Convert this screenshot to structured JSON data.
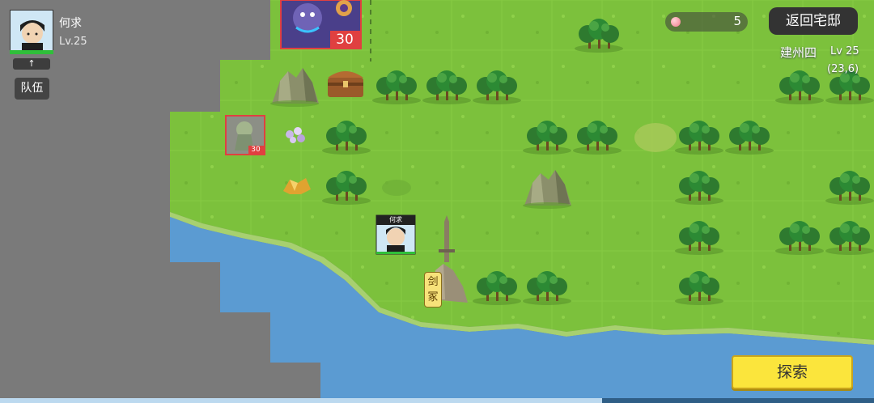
{
  "player": {
    "name": "何求",
    "level": "Lv.25",
    "expand_icon": "up-arrow-icon",
    "up_glyph": "↑",
    "team_label": "队伍"
  },
  "top_right": {
    "peach_icon": "peach-icon",
    "peach_count": "5",
    "return_label": "返回宅邸",
    "location_name": "建州四",
    "location_level": "Lv 25",
    "coords": "(23,6)"
  },
  "map": {
    "monster_big_level": "30",
    "monster_small_level": "30",
    "hero_tag": "何求",
    "landmark_label_1": "剑",
    "landmark_label_2": "冢"
  },
  "explore_label": "探索",
  "colors": {
    "grass": "#7cc13c",
    "water": "#5b9bd2",
    "fog": "#7a7a7a",
    "explore_button": "#fbe53c"
  }
}
